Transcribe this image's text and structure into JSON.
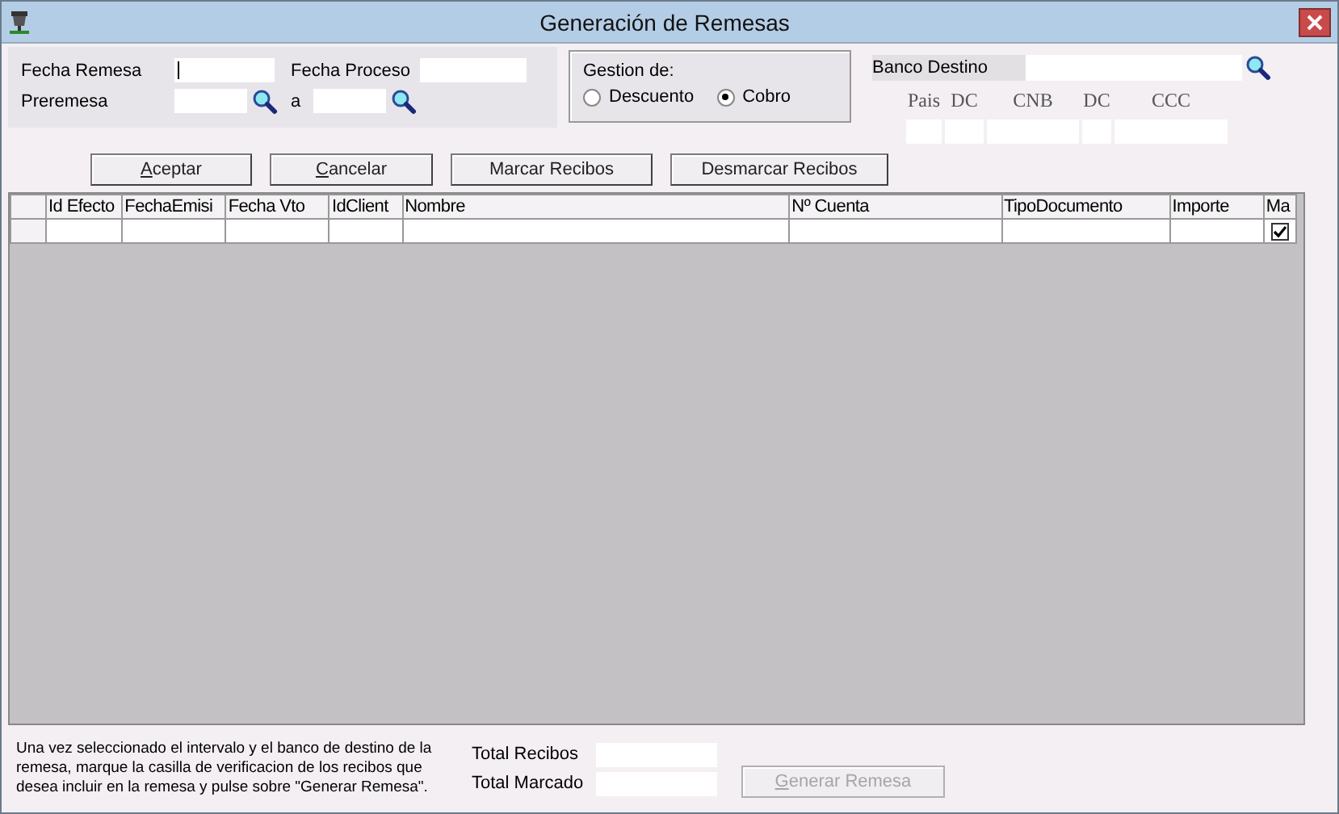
{
  "window": {
    "title": "Generación de Remesas"
  },
  "filters": {
    "fecha_remesa": {
      "label": "Fecha Remesa",
      "focused": true
    },
    "fecha_proceso": {
      "label": "Fecha Proceso"
    },
    "preremesa": {
      "label": "Preremesa"
    },
    "range_separator": "a"
  },
  "gestion": {
    "title": "Gestion de:",
    "options": [
      {
        "label": "Descuento",
        "selected": false
      },
      {
        "label": "Cobro",
        "selected": true
      }
    ]
  },
  "banco": {
    "label": "Banco Destino",
    "account_labels": [
      "Pais",
      "DC",
      "CNB",
      "DC",
      "CCC"
    ]
  },
  "buttons": [
    {
      "label": "Aceptar",
      "underline_first": true
    },
    {
      "label": "Cancelar",
      "underline_first": true
    },
    {
      "label": "Marcar Recibos",
      "underline_first": false
    },
    {
      "label": "Desmarcar Recibos",
      "underline_first": false
    }
  ],
  "table": {
    "columns": [
      "Id Efecto",
      "FechaEmisi",
      "Fecha Vto",
      "IdClient",
      "Nombre",
      "Nº Cuenta",
      "TipoDocumento",
      "Importe",
      "Ma"
    ],
    "rows": [
      {
        "marked": true
      }
    ]
  },
  "footer": {
    "help": "Una vez seleccionado el intervalo y el banco de destino de la remesa, marque la casilla de verificacion de los recibos que desea incluir en la remesa y pulse sobre \"Generar Remesa\".",
    "totals": [
      {
        "label": "Total Recibos"
      },
      {
        "label": "Total Marcado"
      }
    ],
    "generate_button": {
      "label": "Generar Remesa",
      "disabled": true,
      "underline_first": true
    }
  }
}
